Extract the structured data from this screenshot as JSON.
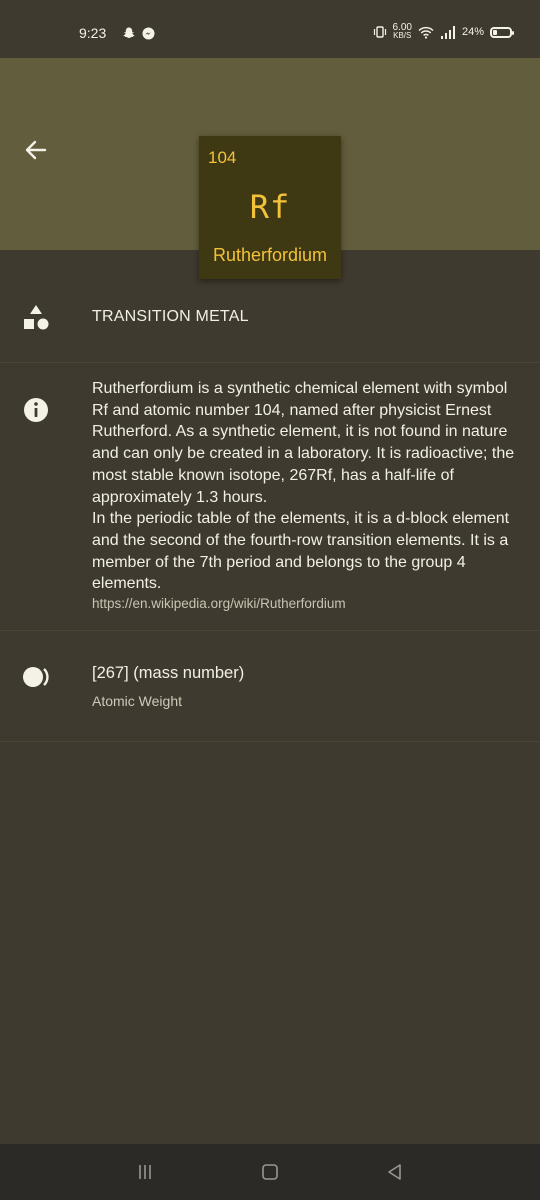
{
  "status_bar": {
    "time": "9:23",
    "net_speed_value": "6.00",
    "net_speed_unit": "KB/S",
    "battery": "24%",
    "battery_level": 0.24,
    "icons": [
      "snapchat-icon",
      "messenger-icon",
      "vibrate-icon",
      "wifi-icon",
      "signal-icon",
      "battery-icon"
    ]
  },
  "header": {
    "back_icon": "back-arrow-icon",
    "color": "#625d3c"
  },
  "element": {
    "number": "104",
    "symbol": "Rf",
    "name": "Rutherfordium",
    "tile_color": "#3e3813",
    "text_color": "#f3c23a"
  },
  "category": {
    "icon": "shapes-icon",
    "label": "TRANSITION METAL"
  },
  "description": {
    "icon": "info-icon",
    "text": "Rutherfordium is a synthetic chemical element with symbol Rf and atomic number 104, named after physicist Ernest Rutherford. As a synthetic element, it is not found in nature and can only be created in a laboratory. It is radioactive; the most stable known isotope, 267Rf, has a half-life of approximately 1.3 hours.\nIn the periodic table of the elements, it is a d-block element and the second of the fourth-row transition elements. It is a member of the 7th period and belongs to the group 4 elements.",
    "link": "https://en.wikipedia.org/wiki/Rutherfordium"
  },
  "atomic_weight": {
    "icon": "weight-icon",
    "value": "[267] (mass number)",
    "label": "Atomic Weight"
  },
  "nav_bar": {
    "buttons": [
      "recent-apps-icon",
      "home-icon",
      "back-triangle-icon"
    ]
  }
}
